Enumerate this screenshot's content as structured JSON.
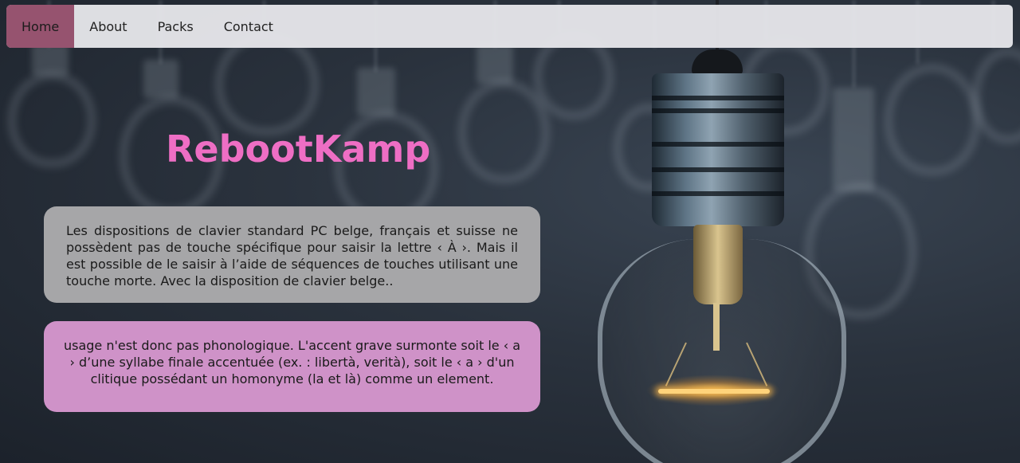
{
  "nav": {
    "items": [
      {
        "label": "Home",
        "active": true
      },
      {
        "label": "About",
        "active": false
      },
      {
        "label": "Packs",
        "active": false
      },
      {
        "label": "Contact",
        "active": false
      }
    ],
    "active_color": "#96536f"
  },
  "hero": {
    "title": "RebootKamp",
    "title_color": "#ee6ec4"
  },
  "cards": [
    {
      "text": "Les dispositions de clavier standard PC belge, français et suisse ne possèdent pas de touche spécifique pour saisir la lettre ‹ À ›. Mais il est possible de le saisir à l’aide de séquences de touches utilisant une touche morte. Avec la disposition de clavier belge..",
      "background": "#a6a6a8"
    },
    {
      "text": "usage n'est donc pas phonologique. L'accent grave surmonte soit le ‹ a › d’une syllabe finale accentuée (ex. : libertà, verità), soit le ‹ a › d'un clitique possédant un homonyme (la et là) comme un element.",
      "background": "#cf92c8"
    }
  ],
  "background": {
    "image": "light-bulbs-photo"
  }
}
